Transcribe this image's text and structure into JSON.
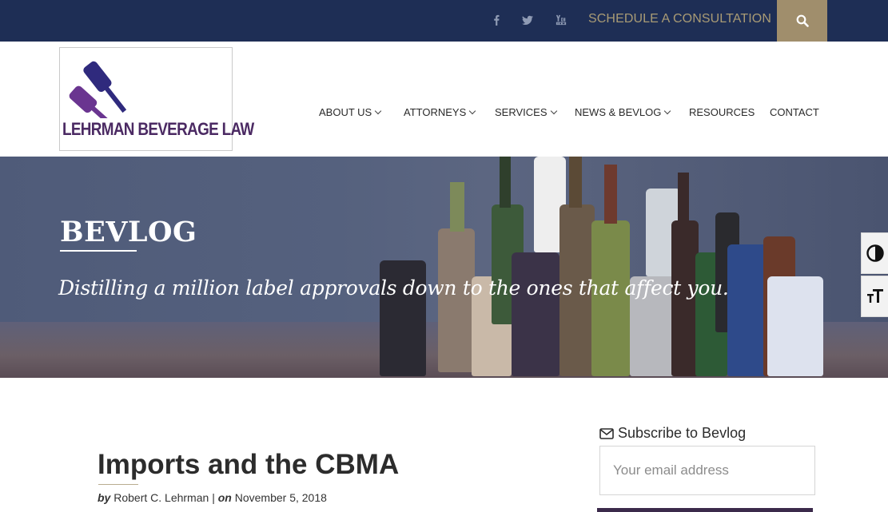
{
  "topbar": {
    "social": [
      {
        "name": "facebook-icon"
      },
      {
        "name": "twitter-icon"
      },
      {
        "name": "youtube-icon"
      }
    ],
    "schedule_label": "SCHEDULE A CONSULTATION",
    "colors": {
      "background": "#1e2e55",
      "accent": "#a08e6c",
      "link": "#a99b75"
    }
  },
  "logo": {
    "text": "LEHRMAN BEVERAGE LAW",
    "colors": {
      "purple_dark": "#3a2d7a",
      "purple_light": "#6f3a8a"
    }
  },
  "nav": {
    "items": [
      {
        "label": "ABOUT US",
        "has_dropdown": true
      },
      {
        "label": "ATTORNEYS",
        "has_dropdown": true
      },
      {
        "label": "SERVICES",
        "has_dropdown": true
      },
      {
        "label": "NEWS & BEVLOG",
        "has_dropdown": true
      },
      {
        "label": "RESOURCES",
        "has_dropdown": false
      },
      {
        "label": "CONTACT",
        "has_dropdown": false
      }
    ]
  },
  "hero": {
    "title": "BEVLOG",
    "subtitle": "Distilling a million label approvals down to the ones that affect you."
  },
  "accessibility": {
    "contrast_icon": "contrast-icon",
    "text_size_icon": "text-size-icon"
  },
  "post": {
    "title": "Imports and the CBMA",
    "by_label": "by",
    "author": "Robert C. Lehrman",
    "separator": "|",
    "on_label": "on",
    "date": "November 5, 2018"
  },
  "sidebar": {
    "subscribe_title": "Subscribe to Bevlog",
    "email_placeholder": "Your email address",
    "email_value": ""
  }
}
